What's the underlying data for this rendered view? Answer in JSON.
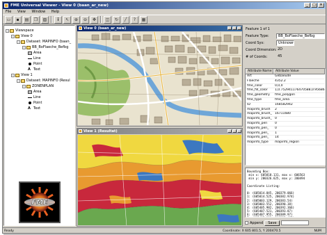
{
  "window": {
    "title": "FME Universal Viewer - View 0 (baan_ar_new)"
  },
  "menu": [
    "File",
    "View",
    "Window",
    "Help"
  ],
  "toolbar_icons": [
    "open-icon",
    "save-icon",
    "print-icon",
    "copy-icon",
    "paste-icon",
    "info-icon",
    "select-icon",
    "zoom-in-icon",
    "zoom-out-icon",
    "pan-icon",
    "zoom-extent-icon",
    "refresh-icon",
    "measure-icon",
    "query-icon",
    "grid-icon",
    "settings-icon"
  ],
  "tree": [
    {
      "label": "Viewspace",
      "indent": 0,
      "icon": "folder",
      "exp": "-"
    },
    {
      "label": "View 0",
      "indent": 1,
      "icon": "folder",
      "exp": "-"
    },
    {
      "label": "Dataset: MAPINFO (baan_",
      "indent": 2,
      "icon": "folder",
      "exp": "-"
    },
    {
      "label": "BB_BoFlaeche_Befbg",
      "indent": 3,
      "icon": "folder",
      "exp": "-"
    },
    {
      "label": "Area",
      "indent": 4,
      "icon": "ar",
      "exp": ""
    },
    {
      "label": "Line",
      "indent": 4,
      "icon": "ln",
      "exp": ""
    },
    {
      "label": "Point",
      "indent": 4,
      "icon": "pt",
      "exp": ""
    },
    {
      "label": "Text",
      "indent": 4,
      "icon": "txt",
      "exp": ""
    },
    {
      "label": "View 1",
      "indent": 1,
      "icon": "folder",
      "exp": "-"
    },
    {
      "label": "Dataset: MAPINFO (Resul",
      "indent": 2,
      "icon": "folder",
      "exp": "-"
    },
    {
      "label": "ZONENPLAN",
      "indent": 3,
      "icon": "folder",
      "exp": "-"
    },
    {
      "label": "Area",
      "indent": 4,
      "icon": "ar",
      "exp": ""
    },
    {
      "label": "Line",
      "indent": 4,
      "icon": "ln",
      "exp": ""
    },
    {
      "label": "Point",
      "indent": 4,
      "icon": "pt",
      "exp": ""
    },
    {
      "label": "Text",
      "indent": 4,
      "icon": "txt",
      "exp": ""
    }
  ],
  "view0": {
    "title": "View 0 (baan_ar_new)"
  },
  "view1": {
    "title": "View 1 (Resultat)"
  },
  "feature_panel": {
    "feature_count": "Feature 1 of 1",
    "feature_type_label": "Feature Type:",
    "feature_type_value": "BB_BoFlaeche_Befbg",
    "coord_sys_label": "Coord Sys:",
    "coord_sys_value": "Unknown",
    "coord_dim_label": "Coord Dimension:",
    "coord_dim_value": "2D",
    "num_coords_label": "# of Coords:",
    "num_coords_value": "45"
  },
  "attributes": {
    "headers": [
      "Attribute Name",
      "Attribute Value"
    ],
    "rows": [
      [
        "Art",
        "Gebaeude"
      ],
      [
        "Flaeche",
        "4352.2"
      ],
      [
        "fme_color",
        "0,0,0"
      ],
      [
        "fme_fill_color",
        "1,0.752941176470588,0.956863"
      ],
      [
        "fme_geometry",
        "fme_polygon"
      ],
      [
        "fme_type",
        "fme_area"
      ],
      [
        "ID",
        "168582942"
      ],
      [
        "mapinfo_brush",
        "2"
      ],
      [
        "mapinfo_brush_",
        "16711680"
      ],
      [
        "mapinfo_brush_",
        "0"
      ],
      [
        "mapinfo_pen",
        "0"
      ],
      [
        "mapinfo_pen_",
        "0"
      ],
      [
        "mapinfo_pen_",
        "1"
      ],
      [
        "mapinfo_pen_",
        "14"
      ],
      [
        "mapinfo_type",
        "mapinfo_region"
      ]
    ]
  },
  "log": [
    "Bounding Box:",
    " min x: 605818.131, max x: 606563",
    " min y: 200326.625, max y: 200494",
    "",
    "Coordinate Listing:",
    "",
    "0: (605014.845, 200379.066)",
    "1: (605014.525, 200382.974)",
    "2: (605003.129, 200383.54)",
    "3: (605003.552, 200390.38)",
    "4: (605405.982, 200392.366)",
    "5: (605407.521, 200393.87)",
    "6: (605407.955, 200389.97)",
    "7: (605405.901, 200393.485)",
    "8: (605404.797, 200394.06)",
    "9: (605404.225, 200395.48)"
  ],
  "bottom": {
    "append_label": "Append",
    "save_label": "Save"
  },
  "status": {
    "left": "Ready",
    "coord": "Coordinate: X 605 801.5, Y 200470.5",
    "num": "NUM"
  },
  "colors": {
    "title_active": "#0a246a",
    "zone_orange": "#e89a30",
    "zone_yellow": "#f0d840",
    "zone_red": "#c8283c",
    "zone_green": "#6aa84f",
    "zone_blue": "#3c78c0"
  }
}
